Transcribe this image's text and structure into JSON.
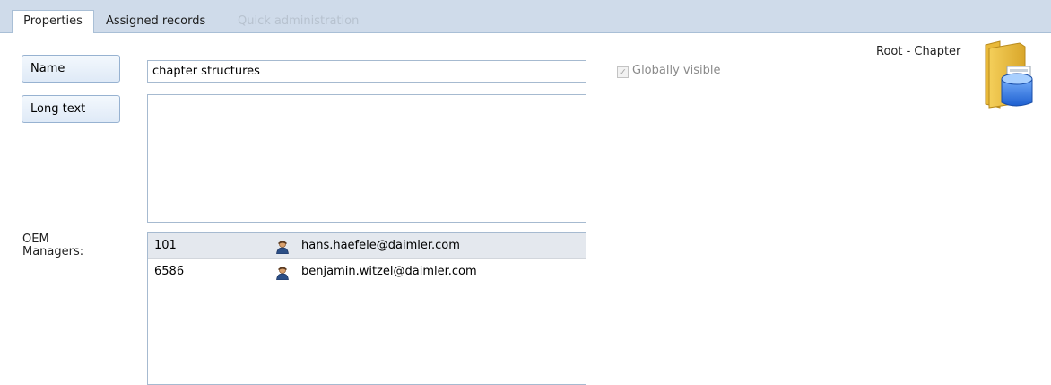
{
  "tabs": [
    {
      "label": "Properties",
      "state": "active"
    },
    {
      "label": "Assigned records",
      "state": "normal"
    },
    {
      "label": "Quick administration",
      "state": "disabled"
    }
  ],
  "form": {
    "name_button": "Name",
    "name_value": "chapter structures",
    "longtext_button": "Long text",
    "longtext_value": "",
    "globally_visible_label": "Globally visible",
    "globally_visible_checked": true,
    "globally_visible_enabled": false
  },
  "node": {
    "label": "Root - Chapter",
    "icon": "folder-database-icon"
  },
  "oem_managers": {
    "label": "OEM Managers:",
    "rows": [
      {
        "id": "101",
        "email": "hans.haefele@daimler.com",
        "icon": "user-icon",
        "selected": true
      },
      {
        "id": "6586",
        "email": "benjamin.witzel@daimler.com",
        "icon": "user-icon",
        "selected": false
      }
    ]
  },
  "colors": {
    "tabstrip": "#cfdbea",
    "button_border": "#97b2d1",
    "field_border": "#a6bad0",
    "selected_row": "#e4e8ee"
  }
}
